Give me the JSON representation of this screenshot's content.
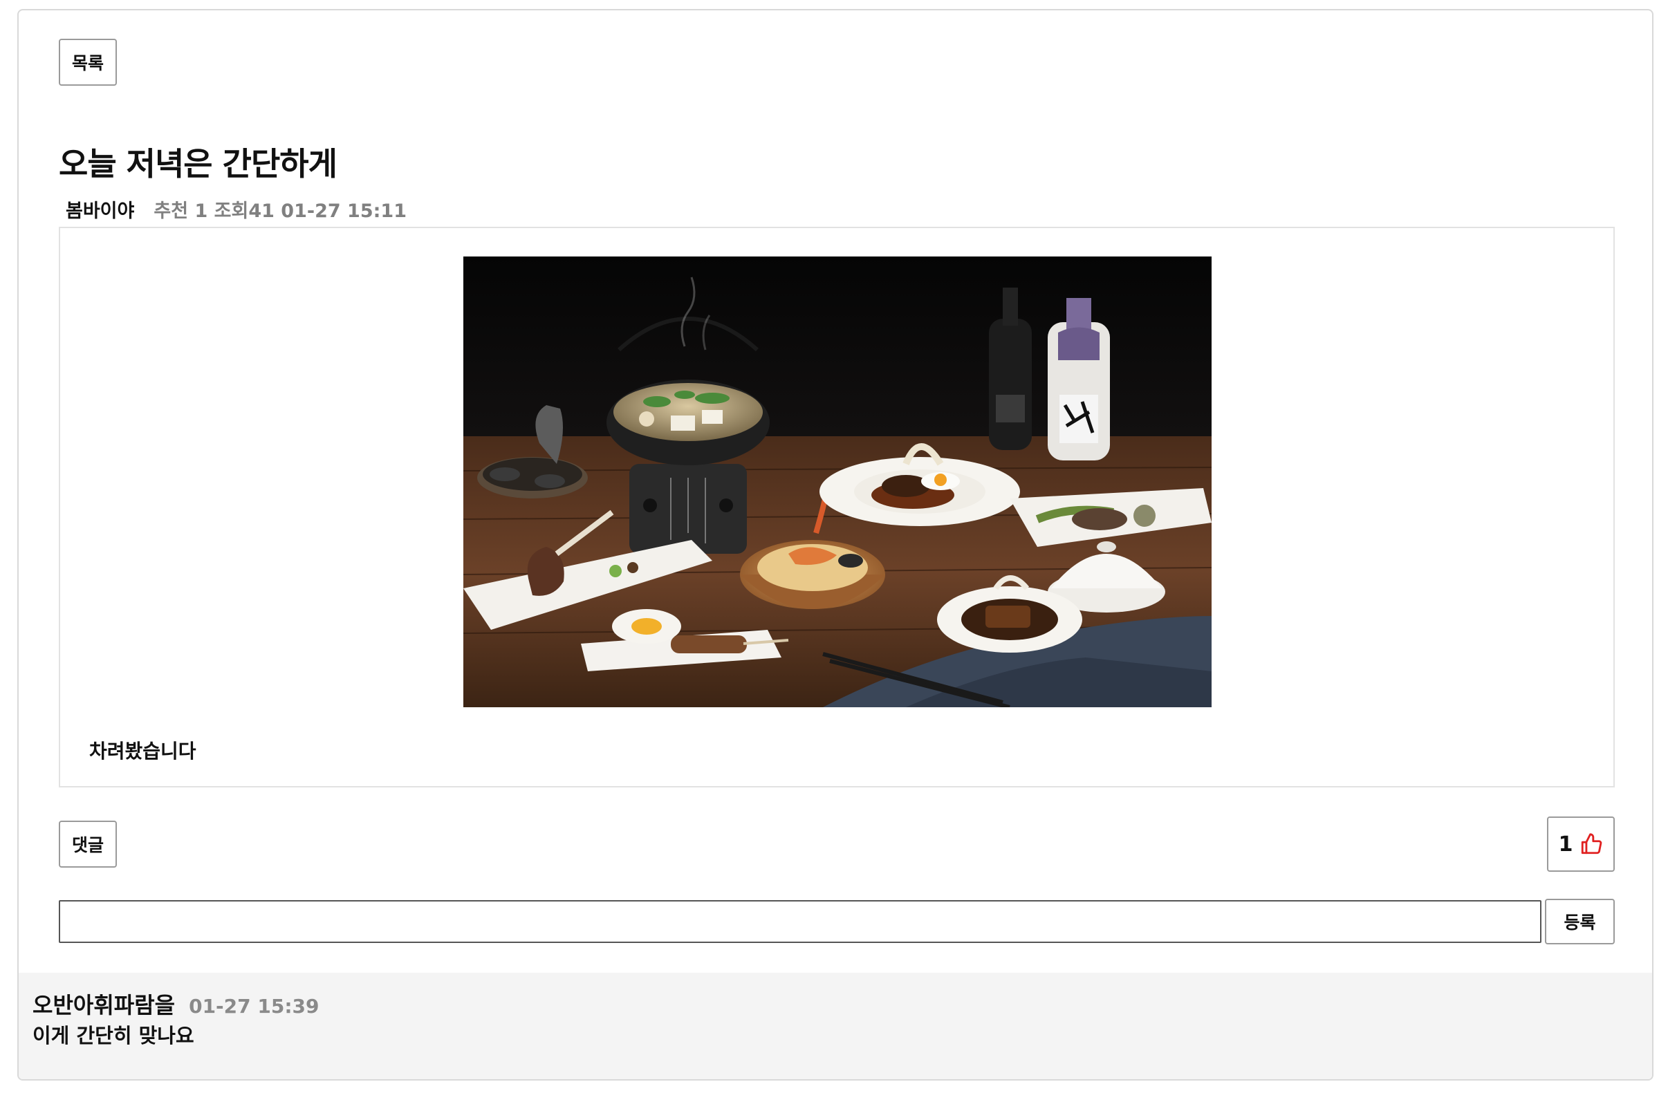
{
  "toolbar": {
    "list_label": "목록"
  },
  "post": {
    "title": "오늘 저녁은 간단하게",
    "author": "봄바이야",
    "stats": "추천 1 조회41 01-27 15:11",
    "body": "차려봤습니다",
    "image_alt": "japanese-dinner-table-photo"
  },
  "actions": {
    "comment_label": "댓글",
    "like_count": "1",
    "like_icon": "thumbs-up-icon",
    "like_color": "#e02020"
  },
  "comment_form": {
    "input_value": "",
    "placeholder": "",
    "submit_label": "등록"
  },
  "comments": [
    {
      "author": "오반아휘파람을",
      "time": "01-27 15:39",
      "text": "이게 간단히 맞나요"
    }
  ]
}
